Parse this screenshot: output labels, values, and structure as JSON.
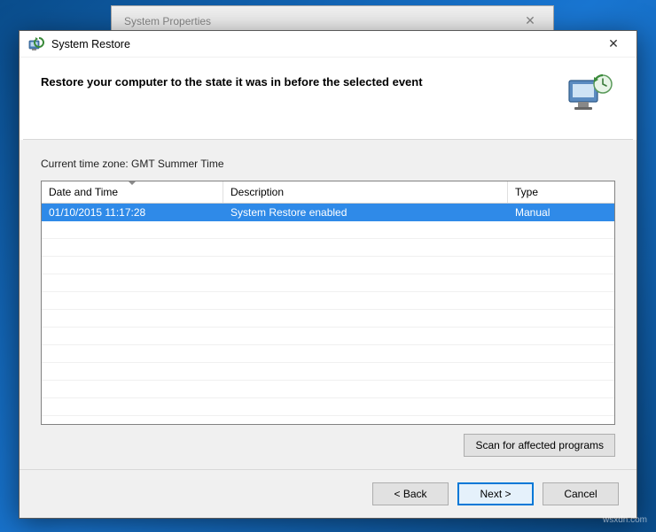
{
  "background_window": {
    "title": "System Properties"
  },
  "wizard": {
    "title": "System Restore",
    "heading": "Restore your computer to the state it was in before the selected event",
    "timezone_label": "Current time zone: GMT Summer Time",
    "columns": {
      "date_time": "Date and Time",
      "description": "Description",
      "type": "Type"
    },
    "rows": [
      {
        "date_time": "01/10/2015 11:17:28",
        "description": "System Restore enabled",
        "type": "Manual",
        "selected": true
      }
    ],
    "scan_button": "Scan for affected programs",
    "buttons": {
      "back": "< Back",
      "next": "Next >",
      "cancel": "Cancel"
    }
  },
  "watermark": "wsxdn.com"
}
